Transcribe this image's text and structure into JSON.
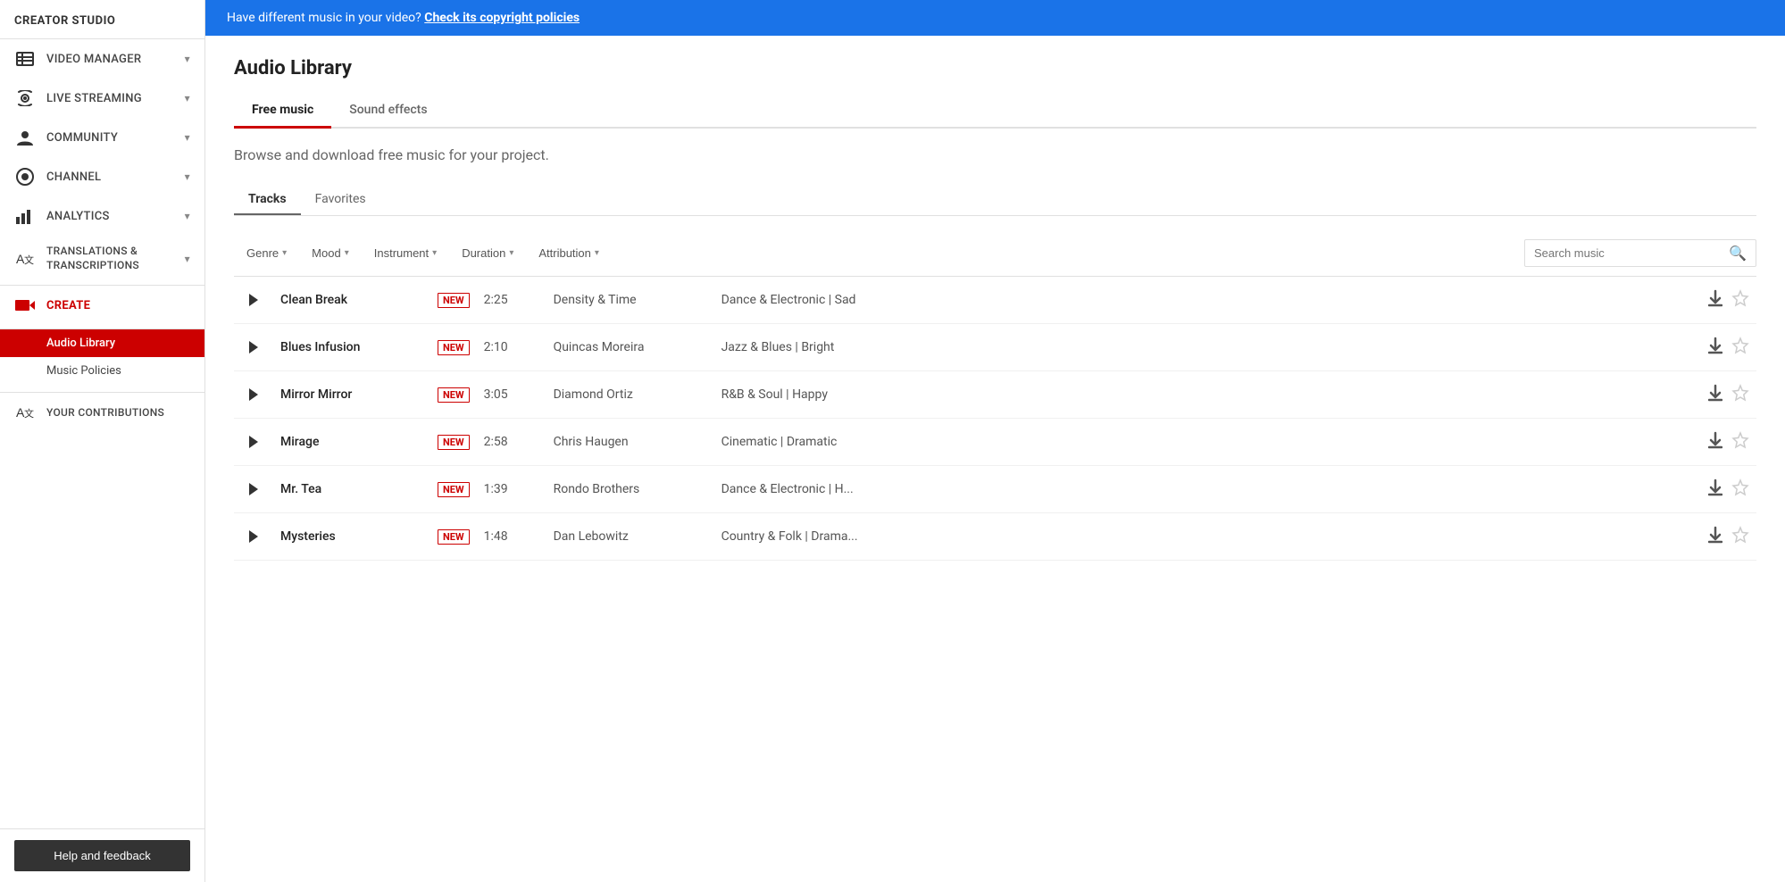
{
  "sidebar": {
    "title": "CREATOR STUDIO",
    "items": [
      {
        "id": "video-manager",
        "label": "VIDEO MANAGER",
        "icon": "video-manager-icon",
        "hasChevron": true
      },
      {
        "id": "live-streaming",
        "label": "LIVE STREAMING",
        "icon": "live-streaming-icon",
        "hasChevron": true
      },
      {
        "id": "community",
        "label": "COMMUNITY",
        "icon": "community-icon",
        "hasChevron": true
      },
      {
        "id": "channel",
        "label": "CHANNEL",
        "icon": "channel-icon",
        "hasChevron": true
      },
      {
        "id": "analytics",
        "label": "ANALYTICS",
        "icon": "analytics-icon",
        "hasChevron": true
      },
      {
        "id": "translations",
        "label": "TRANSLATIONS & TRANSCRIPTIONS",
        "icon": "translations-icon",
        "hasChevron": true
      },
      {
        "id": "create",
        "label": "CREATE",
        "icon": "create-icon",
        "hasChevron": false,
        "isCreate": true
      }
    ],
    "subItems": [
      {
        "id": "audio-library",
        "label": "Audio Library",
        "active": true
      },
      {
        "id": "music-policies",
        "label": "Music Policies",
        "active": false
      }
    ],
    "yourContributions": "YOUR CONTRIBUTIONS",
    "helpBtn": "Help and feedback"
  },
  "banner": {
    "text": "Have different music in your video?",
    "linkText": "Check its copyright policies"
  },
  "main": {
    "title": "Audio Library",
    "tabs": [
      {
        "id": "free-music",
        "label": "Free music",
        "active": true
      },
      {
        "id": "sound-effects",
        "label": "Sound effects",
        "active": false
      }
    ],
    "browseText": "Browse and download free music for your project.",
    "subTabs": [
      {
        "id": "tracks",
        "label": "Tracks",
        "active": true
      },
      {
        "id": "favorites",
        "label": "Favorites",
        "active": false
      }
    ],
    "filters": [
      {
        "id": "genre",
        "label": "Genre"
      },
      {
        "id": "mood",
        "label": "Mood"
      },
      {
        "id": "instrument",
        "label": "Instrument"
      },
      {
        "id": "duration",
        "label": "Duration"
      },
      {
        "id": "attribution",
        "label": "Attribution"
      }
    ],
    "searchPlaceholder": "Search music",
    "tracks": [
      {
        "name": "Clean Break",
        "isNew": true,
        "duration": "2:25",
        "artist": "Density & Time",
        "genre": "Dance & Electronic | Sad"
      },
      {
        "name": "Blues Infusion",
        "isNew": true,
        "duration": "2:10",
        "artist": "Quincas Moreira",
        "genre": "Jazz & Blues | Bright"
      },
      {
        "name": "Mirror Mirror",
        "isNew": true,
        "duration": "3:05",
        "artist": "Diamond Ortiz",
        "genre": "R&B & Soul | Happy"
      },
      {
        "name": "Mirage",
        "isNew": true,
        "duration": "2:58",
        "artist": "Chris Haugen",
        "genre": "Cinematic | Dramatic"
      },
      {
        "name": "Mr. Tea",
        "isNew": true,
        "duration": "1:39",
        "artist": "Rondo Brothers",
        "genre": "Dance & Electronic | H..."
      },
      {
        "name": "Mysteries",
        "isNew": true,
        "duration": "1:48",
        "artist": "Dan Lebowitz",
        "genre": "Country & Folk | Drama..."
      }
    ]
  }
}
